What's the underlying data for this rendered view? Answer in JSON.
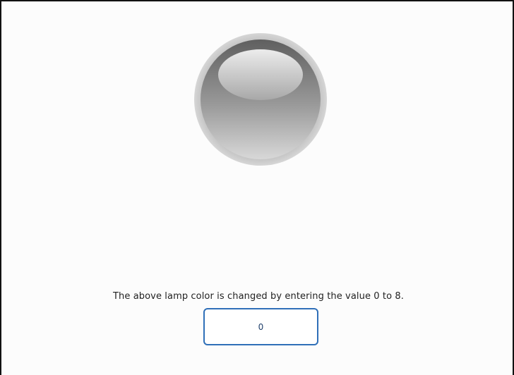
{
  "lamp": {
    "icon": "lamp-icon",
    "color_state": "gray",
    "colors": {
      "ring": "#c8c8c8",
      "body_top": "#6a6a6a",
      "body_bottom": "#d4d4d4",
      "highlight": "#e6e6e6"
    }
  },
  "instruction": {
    "text": "The above lamp color is changed by entering the value 0 to 8."
  },
  "value_input": {
    "value": "0",
    "accent": "#2f6fb8"
  }
}
